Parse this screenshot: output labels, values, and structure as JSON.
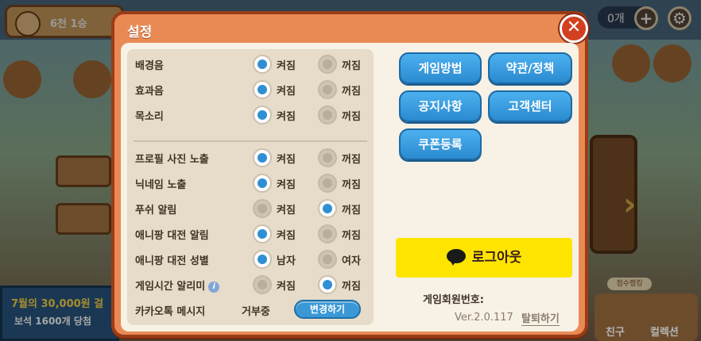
{
  "background": {
    "rank": "6천 1승",
    "count": "0개",
    "plus_label": "+",
    "banner_line1": "7월의 30,000원 걸",
    "banner_line2": "보석 1600개 당첨",
    "rank_pill": "점수랭킹",
    "friend_label": "친구",
    "collection_label": "컬렉션"
  },
  "dialog": {
    "title": "설정",
    "close_glyph": "✕"
  },
  "settings": {
    "on_label": "켜짐",
    "off_label": "꺼짐",
    "rows": [
      {
        "label": "배경음",
        "selected": "on"
      },
      {
        "label": "효과음",
        "selected": "on"
      },
      {
        "label": "목소리",
        "selected": "on"
      },
      {
        "label": "프로필 사진 노출",
        "selected": "on"
      },
      {
        "label": "닉네임 노출",
        "selected": "on"
      },
      {
        "label": "푸쉬 알림",
        "selected": "off"
      },
      {
        "label": "애니팡 대전 알림",
        "selected": "on"
      },
      {
        "label": "애니팡 대전 성별",
        "selected": "male",
        "option1": "남자",
        "option2": "여자"
      },
      {
        "label": "게임시간 알리미",
        "selected": "off",
        "info_glyph": "i"
      }
    ],
    "kakao": {
      "label": "카카오톡 메시지",
      "status": "거부중",
      "button": "변경하기"
    }
  },
  "buttons": {
    "how_to_play": "게임방법",
    "terms": "약관/정책",
    "notice": "공지사항",
    "support": "고객센터",
    "coupon": "쿠폰등록",
    "logout": "로그아웃"
  },
  "footer": {
    "member_number_label": "게임회원번호:",
    "version": "Ver.2.0.117",
    "withdraw": "탈퇴하기"
  },
  "colors": {
    "dialog_orange": "#e98a55",
    "radio_blue": "#2e8fd3",
    "button_blue": "#2b8ad0",
    "kakao_yellow": "#fee500"
  }
}
